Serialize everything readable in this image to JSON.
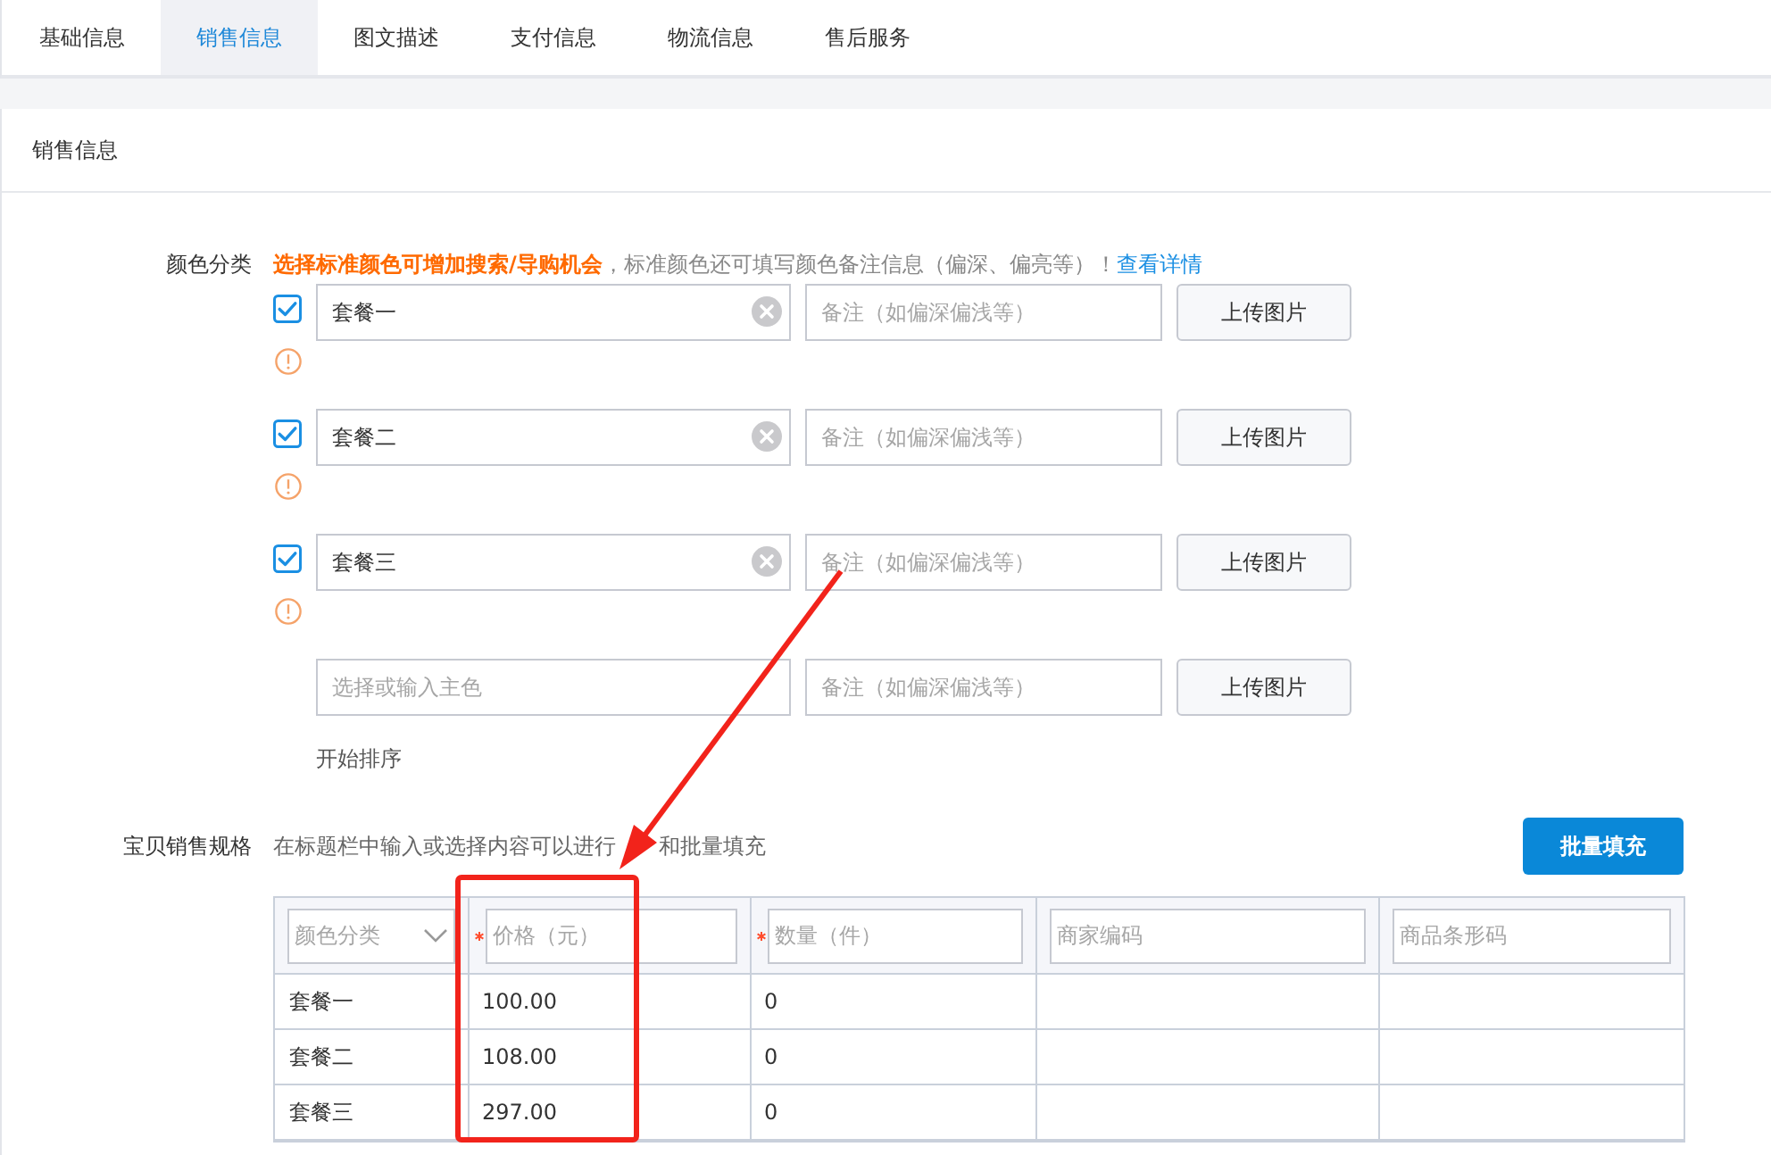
{
  "tabs": [
    {
      "label": "基础信息",
      "selected": false
    },
    {
      "label": "销售信息",
      "selected": true
    },
    {
      "label": "图文描述",
      "selected": false
    },
    {
      "label": "支付信息",
      "selected": false
    },
    {
      "label": "物流信息",
      "selected": false
    },
    {
      "label": "售后服务",
      "selected": false
    }
  ],
  "section": {
    "title": "销售信息"
  },
  "color_category": {
    "label": "颜色分类",
    "hint": "**选择标准颜色可增加搜索/导购机会**，标准颜色还可填写颜色备注信息（偏深、偏亮等）！",
    "hint_link": "查看详情",
    "rows": [
      {
        "kind": "option",
        "checked": true,
        "value": "套餐一",
        "remark_placeholder": "备注（如偏深偏浅等）",
        "upload": "上传图片"
      },
      {
        "kind": "option",
        "checked": true,
        "value": "套餐二",
        "remark_placeholder": "备注（如偏深偏浅等）",
        "upload": "上传图片"
      },
      {
        "kind": "option",
        "checked": true,
        "value": "套餐三",
        "remark_placeholder": "备注（如偏深偏浅等）",
        "upload": "上传图片"
      },
      {
        "kind": "new",
        "placeholder": "选择或输入主色",
        "remark_placeholder": "备注（如偏深偏浅等）",
        "upload": "上传图片"
      }
    ],
    "sort_link": "开始排序"
  },
  "sales_spec": {
    "label": "宝贝销售规格",
    "hint": "在标题栏中输入或选择内容可以进行",
    "hint_end": "和批量填充",
    "button": "批量填充",
    "columns": [
      {
        "kind": "select",
        "placeholder": "颜色分类",
        "required": false
      },
      {
        "kind": "input",
        "placeholder": "价格（元）",
        "required": true
      },
      {
        "kind": "input",
        "placeholder": "数量（件）",
        "required": true
      },
      {
        "kind": "input",
        "placeholder": "商家编码",
        "required": false
      },
      {
        "kind": "input",
        "placeholder": "商品条形码",
        "required": false
      }
    ],
    "rows": [
      {
        "cells": [
          "套餐一",
          "100.00",
          "0"
        ]
      },
      {
        "cells": [
          "套餐二",
          "108.00",
          "0"
        ]
      },
      {
        "cells": [
          "套餐三",
          "297.00",
          "0"
        ]
      }
    ]
  }
}
